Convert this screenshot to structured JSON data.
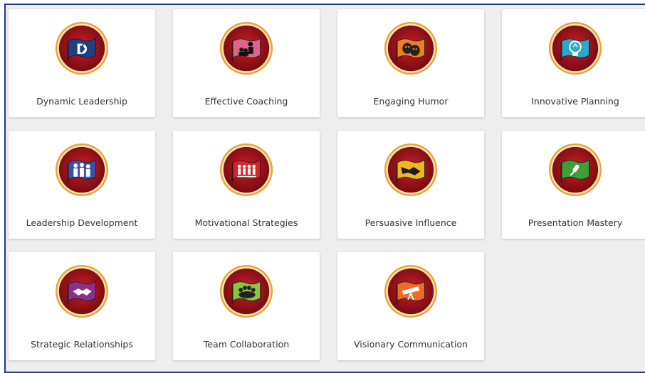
{
  "cards": [
    {
      "label": "Dynamic Leadership",
      "icon": "lightning-d-icon",
      "flag_color": "#1f3f86"
    },
    {
      "label": "Effective Coaching",
      "icon": "coaching-audience-icon",
      "flag_color": "#e0638e"
    },
    {
      "label": "Engaging Humor",
      "icon": "theater-masks-icon",
      "flag_color": "#f07f1e"
    },
    {
      "label": "Innovative Planning",
      "icon": "lightbulb-icon",
      "flag_color": "#2fa6c8"
    },
    {
      "label": "Leadership Development",
      "icon": "people-group-icon",
      "flag_color": "#3c4fa8"
    },
    {
      "label": "Motivational Strategies",
      "icon": "team-figures-icon",
      "flag_color": "#d6202a"
    },
    {
      "label": "Persuasive Influence",
      "icon": "handshake-reach-icon",
      "flag_color": "#f0b81d"
    },
    {
      "label": "Presentation Mastery",
      "icon": "microphone-icon",
      "flag_color": "#3f9d3a"
    },
    {
      "label": "Strategic Relationships",
      "icon": "handshake-icon",
      "flag_color": "#8a2f8c"
    },
    {
      "label": "Team Collaboration",
      "icon": "team-huddle-icon",
      "flag_color": "#8cc63e"
    },
    {
      "label": "Visionary Communication",
      "icon": "telescope-icon",
      "flag_color": "#f06b2a"
    }
  ]
}
